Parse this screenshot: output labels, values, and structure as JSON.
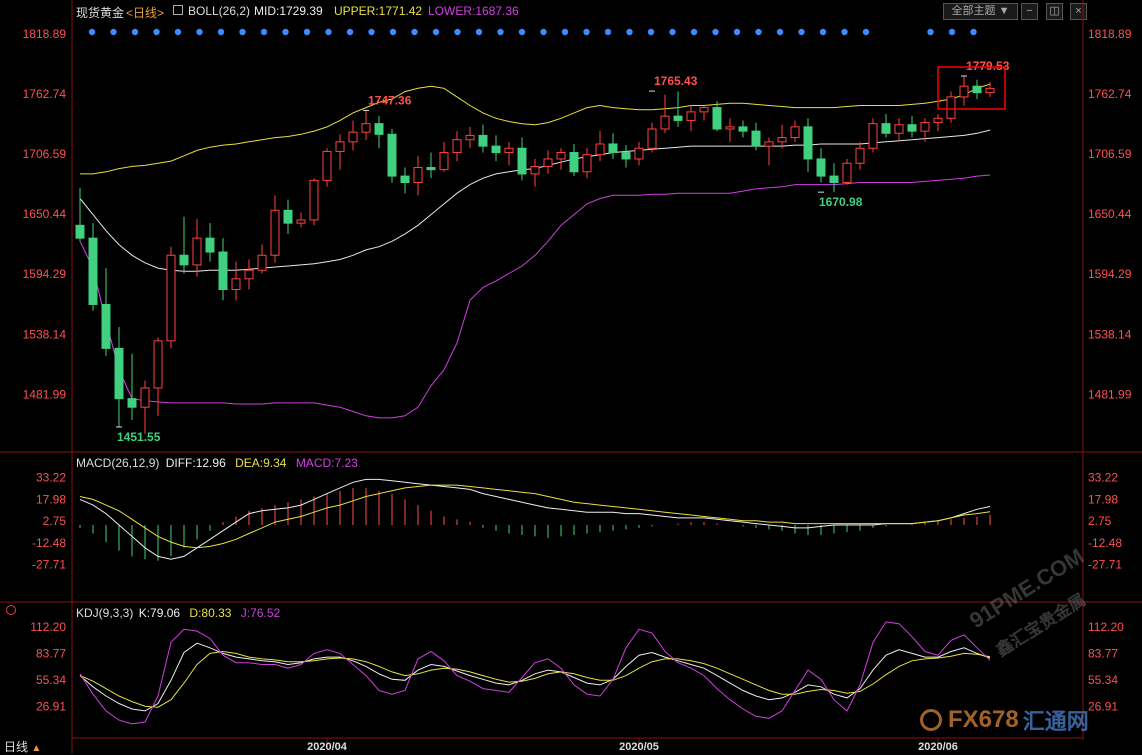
{
  "header": {
    "instrument": "现货黄金",
    "period_tag": "<日线>",
    "boll_label": "BOLL(26,2)",
    "mid_label": "MID:1729.39",
    "upper_label": "UPPER:1771.42",
    "lower_label": "LOWER:1687.36",
    "topic_button": "全部主题",
    "menu_icon": "triangle-down-icon"
  },
  "colors": {
    "up": "#ff4040",
    "down": "#40d080",
    "mid": "#e8e8e8",
    "upper": "#e8e040",
    "lower": "#d040e0",
    "axis_text_red": "#ff5050",
    "dot": "#3a8cff",
    "highlight_box": "#ff0000"
  },
  "chart_data": [
    {
      "type": "candlestick",
      "name": "price",
      "ylim": [
        1430,
        1830
      ],
      "yticks": [
        1818.89,
        1762.74,
        1706.59,
        1650.44,
        1594.29,
        1538.14,
        1481.99
      ],
      "annotations": [
        {
          "text": "1451.55",
          "index": 3,
          "value": 1451.55
        },
        {
          "text": "1747.36",
          "index": 22,
          "value": 1747.36
        },
        {
          "text": "1765.43",
          "index": 44,
          "value": 1765.43
        },
        {
          "text": "1670.98",
          "index": 57,
          "value": 1670.98
        },
        {
          "text": "1779.53",
          "index": 68,
          "value": 1779.53
        }
      ],
      "candles": [
        [
          1640,
          1675,
          1625,
          1628
        ],
        [
          1628,
          1642,
          1560,
          1566
        ],
        [
          1566,
          1600,
          1518,
          1525
        ],
        [
          1525,
          1545,
          1452,
          1478
        ],
        [
          1478,
          1520,
          1458,
          1470
        ],
        [
          1470,
          1495,
          1445,
          1488
        ],
        [
          1488,
          1535,
          1462,
          1532
        ],
        [
          1532,
          1620,
          1525,
          1612
        ],
        [
          1612,
          1648,
          1595,
          1603
        ],
        [
          1603,
          1646,
          1592,
          1628
        ],
        [
          1628,
          1642,
          1606,
          1615
        ],
        [
          1615,
          1628,
          1570,
          1580
        ],
        [
          1580,
          1606,
          1570,
          1590
        ],
        [
          1590,
          1608,
          1580,
          1598
        ],
        [
          1598,
          1622,
          1595,
          1612
        ],
        [
          1612,
          1668,
          1605,
          1654
        ],
        [
          1654,
          1664,
          1632,
          1642
        ],
        [
          1642,
          1652,
          1638,
          1645
        ],
        [
          1645,
          1684,
          1640,
          1682
        ],
        [
          1682,
          1712,
          1676,
          1709
        ],
        [
          1709,
          1725,
          1692,
          1718
        ],
        [
          1718,
          1738,
          1710,
          1727
        ],
        [
          1727,
          1748,
          1720,
          1735
        ],
        [
          1735,
          1742,
          1712,
          1725
        ],
        [
          1725,
          1730,
          1680,
          1686
        ],
        [
          1686,
          1694,
          1670,
          1680
        ],
        [
          1680,
          1705,
          1668,
          1694
        ],
        [
          1694,
          1708,
          1684,
          1692
        ],
        [
          1692,
          1718,
          1690,
          1708
        ],
        [
          1708,
          1728,
          1700,
          1720
        ],
        [
          1720,
          1732,
          1712,
          1724
        ],
        [
          1724,
          1734,
          1708,
          1714
        ],
        [
          1714,
          1724,
          1700,
          1708
        ],
        [
          1708,
          1718,
          1696,
          1712
        ],
        [
          1712,
          1722,
          1682,
          1688
        ],
        [
          1688,
          1702,
          1676,
          1695
        ],
        [
          1695,
          1710,
          1688,
          1702
        ],
        [
          1702,
          1712,
          1692,
          1708
        ],
        [
          1708,
          1716,
          1686,
          1690
        ],
        [
          1690,
          1712,
          1684,
          1706
        ],
        [
          1706,
          1728,
          1700,
          1716
        ],
        [
          1716,
          1726,
          1702,
          1708
        ],
        [
          1708,
          1715,
          1694,
          1702
        ],
        [
          1702,
          1718,
          1696,
          1712
        ],
        [
          1712,
          1736,
          1708,
          1730
        ],
        [
          1730,
          1762,
          1726,
          1742
        ],
        [
          1742,
          1765,
          1732,
          1738
        ],
        [
          1738,
          1752,
          1728,
          1746
        ],
        [
          1746,
          1752,
          1738,
          1750
        ],
        [
          1750,
          1756,
          1728,
          1730
        ],
        [
          1730,
          1740,
          1718,
          1732
        ],
        [
          1732,
          1738,
          1722,
          1728
        ],
        [
          1728,
          1736,
          1710,
          1714
        ],
        [
          1714,
          1722,
          1696,
          1718
        ],
        [
          1718,
          1734,
          1712,
          1722
        ],
        [
          1722,
          1738,
          1718,
          1732
        ],
        [
          1732,
          1740,
          1690,
          1702
        ],
        [
          1702,
          1712,
          1680,
          1686
        ],
        [
          1686,
          1698,
          1671,
          1680
        ],
        [
          1680,
          1702,
          1678,
          1698
        ],
        [
          1698,
          1718,
          1692,
          1712
        ],
        [
          1712,
          1740,
          1708,
          1735
        ],
        [
          1735,
          1744,
          1722,
          1726
        ],
        [
          1726,
          1740,
          1718,
          1734
        ],
        [
          1734,
          1742,
          1722,
          1728
        ],
        [
          1728,
          1740,
          1718,
          1736
        ],
        [
          1736,
          1744,
          1728,
          1740
        ],
        [
          1740,
          1765,
          1736,
          1760
        ],
        [
          1760,
          1780,
          1752,
          1770
        ],
        [
          1770,
          1776,
          1758,
          1764
        ],
        [
          1764,
          1774,
          1760,
          1768
        ]
      ],
      "bands": {
        "upper": [
          1688,
          1688,
          1690,
          1693,
          1695,
          1696,
          1698,
          1700,
          1705,
          1710,
          1713,
          1715,
          1716,
          1718,
          1720,
          1722,
          1723,
          1725,
          1728,
          1732,
          1738,
          1745,
          1750,
          1755,
          1758,
          1765,
          1768,
          1770,
          1768,
          1760,
          1752,
          1745,
          1740,
          1737,
          1735,
          1734,
          1736,
          1740,
          1745,
          1750,
          1752,
          1750,
          1749,
          1748,
          1748,
          1749,
          1750,
          1752,
          1752,
          1753,
          1754,
          1754,
          1753,
          1752,
          1751,
          1750,
          1750,
          1750,
          1750,
          1751,
          1752,
          1752,
          1752,
          1752,
          1753,
          1754,
          1756,
          1758,
          1762,
          1768,
          1772
        ],
        "mid": [
          1665,
          1650,
          1635,
          1622,
          1612,
          1605,
          1600,
          1598,
          1597,
          1597,
          1598,
          1598,
          1598,
          1599,
          1600,
          1601,
          1602,
          1603,
          1604,
          1606,
          1608,
          1612,
          1617,
          1620,
          1625,
          1632,
          1640,
          1650,
          1660,
          1670,
          1678,
          1684,
          1688,
          1690,
          1692,
          1693,
          1696,
          1699,
          1702,
          1704,
          1706,
          1708,
          1709,
          1710,
          1711,
          1712,
          1713,
          1714,
          1714,
          1714,
          1714,
          1714,
          1714,
          1714,
          1714,
          1715,
          1715,
          1716,
          1716,
          1716,
          1716,
          1717,
          1718,
          1719,
          1720,
          1721,
          1722,
          1723,
          1724,
          1726,
          1729
        ],
        "lower": [
          1625,
          1600,
          1550,
          1505,
          1478,
          1476,
          1475,
          1474,
          1474,
          1474,
          1474,
          1474,
          1473,
          1473,
          1473,
          1474,
          1474,
          1474,
          1474,
          1472,
          1470,
          1466,
          1462,
          1460,
          1460,
          1462,
          1470,
          1490,
          1505,
          1530,
          1570,
          1582,
          1588,
          1595,
          1602,
          1612,
          1625,
          1640,
          1650,
          1660,
          1665,
          1668,
          1668,
          1668,
          1669,
          1669,
          1670,
          1670,
          1670,
          1670,
          1670,
          1672,
          1674,
          1675,
          1676,
          1678,
          1678,
          1678,
          1678,
          1679,
          1680,
          1680,
          1680,
          1680,
          1680,
          1681,
          1682,
          1683,
          1684,
          1686,
          1687
        ]
      }
    },
    {
      "type": "bar",
      "name": "MACD",
      "label": "MACD(26,12,9)",
      "diff_label": "DIFF:12.96",
      "dea_label": "DEA:9.34",
      "macd_label": "MACD:7.23",
      "ylim": [
        -40,
        40
      ],
      "yticks": [
        33.22,
        17.98,
        2.75,
        -12.48,
        -27.71
      ],
      "macd": [
        -2,
        -6,
        -12,
        -18,
        -22,
        -24,
        -25,
        -22,
        -16,
        -10,
        -4,
        2,
        6,
        10,
        12,
        14,
        16,
        18,
        20,
        22,
        24,
        26,
        26,
        24,
        22,
        18,
        14,
        10,
        6,
        4,
        2,
        -2,
        -4,
        -6,
        -7,
        -8,
        -9,
        -8,
        -7,
        -6,
        -5,
        -4,
        -3,
        -2,
        -1,
        0,
        1,
        2,
        2,
        1,
        0,
        -1,
        -2,
        -3,
        -4,
        -6,
        -7,
        -7,
        -6,
        -5,
        -4,
        -2,
        -1,
        0,
        1,
        2,
        3,
        4,
        5,
        6,
        7.23
      ],
      "diff": [
        18,
        14,
        8,
        0,
        -8,
        -16,
        -22,
        -24,
        -22,
        -16,
        -10,
        -4,
        2,
        8,
        10,
        11,
        12,
        14,
        18,
        22,
        26,
        30,
        32,
        32,
        31,
        30,
        29,
        28,
        27,
        26,
        25,
        22,
        20,
        18,
        16,
        14,
        12,
        11,
        10,
        9,
        9,
        9,
        8,
        8,
        7,
        6,
        5,
        5,
        5,
        4,
        3,
        2,
        1,
        0,
        -1,
        -2,
        -2,
        -1,
        0,
        0,
        0,
        0,
        1,
        1,
        1,
        2,
        3,
        5,
        8,
        11,
        12.96
      ],
      "dea": [
        20,
        18,
        14,
        10,
        4,
        -2,
        -8,
        -12,
        -15,
        -16,
        -15,
        -13,
        -10,
        -6,
        -2,
        2,
        4,
        6,
        9,
        12,
        14,
        17,
        20,
        22,
        24,
        26,
        27,
        28,
        28,
        28,
        27,
        26,
        25,
        24,
        23,
        22,
        20,
        18,
        16,
        15,
        14,
        13,
        12,
        11,
        10,
        9,
        8,
        7,
        6,
        5,
        4,
        3,
        3,
        2,
        2,
        1,
        1,
        1,
        1,
        1,
        1,
        1,
        1,
        1,
        1,
        2,
        3,
        5,
        7,
        8,
        9.34
      ]
    },
    {
      "type": "line",
      "name": "KDJ",
      "label": "KDJ(9,3,3)",
      "k_label": "K:79.06",
      "d_label": "D:80.33",
      "j_label": "J:76.52",
      "ylim": [
        10,
        120
      ],
      "yticks": [
        112.2,
        83.77,
        55.34,
        26.91
      ],
      "k": [
        60,
        48,
        38,
        30,
        24,
        22,
        30,
        55,
        85,
        95,
        90,
        84,
        80,
        78,
        76,
        75,
        72,
        74,
        78,
        80,
        80,
        76,
        70,
        62,
        56,
        55,
        66,
        72,
        70,
        65,
        60,
        56,
        52,
        50,
        55,
        62,
        66,
        64,
        58,
        52,
        50,
        56,
        70,
        82,
        85,
        80,
        76,
        72,
        68,
        60,
        52,
        44,
        38,
        34,
        36,
        42,
        50,
        48,
        40,
        36,
        46,
        66,
        82,
        88,
        84,
        80,
        80,
        86,
        90,
        84,
        79.06
      ],
      "d": [
        60,
        54,
        46,
        38,
        32,
        27,
        26,
        34,
        52,
        72,
        84,
        86,
        84,
        80,
        78,
        77,
        75,
        75,
        76,
        78,
        79,
        78,
        75,
        70,
        64,
        60,
        62,
        66,
        68,
        67,
        64,
        60,
        56,
        53,
        54,
        57,
        62,
        64,
        62,
        58,
        55,
        55,
        60,
        68,
        75,
        78,
        78,
        76,
        73,
        68,
        62,
        56,
        50,
        44,
        40,
        40,
        43,
        45,
        44,
        41,
        43,
        51,
        61,
        70,
        76,
        78,
        79,
        81,
        84,
        83,
        80.33
      ],
      "j": [
        62,
        40,
        22,
        12,
        8,
        10,
        38,
        96,
        110,
        108,
        100,
        82,
        74,
        74,
        72,
        72,
        68,
        72,
        84,
        88,
        84,
        72,
        60,
        44,
        40,
        44,
        78,
        86,
        76,
        60,
        54,
        46,
        44,
        42,
        58,
        74,
        78,
        68,
        50,
        40,
        38,
        56,
        90,
        110,
        106,
        86,
        74,
        68,
        60,
        46,
        34,
        24,
        16,
        14,
        22,
        44,
        66,
        56,
        34,
        22,
        50,
        96,
        118,
        116,
        102,
        86,
        82,
        98,
        104,
        90,
        76.52
      ]
    }
  ],
  "xaxis": {
    "period_button": "日线",
    "labels": [
      {
        "text": "2020/04",
        "index": 19
      },
      {
        "text": "2020/05",
        "index": 43
      },
      {
        "text": "2020/06",
        "index": 66
      }
    ]
  },
  "watermarks": [
    "91PME.COM",
    "鑫汇宝贵金属",
    "FX678",
    "汇通网"
  ]
}
